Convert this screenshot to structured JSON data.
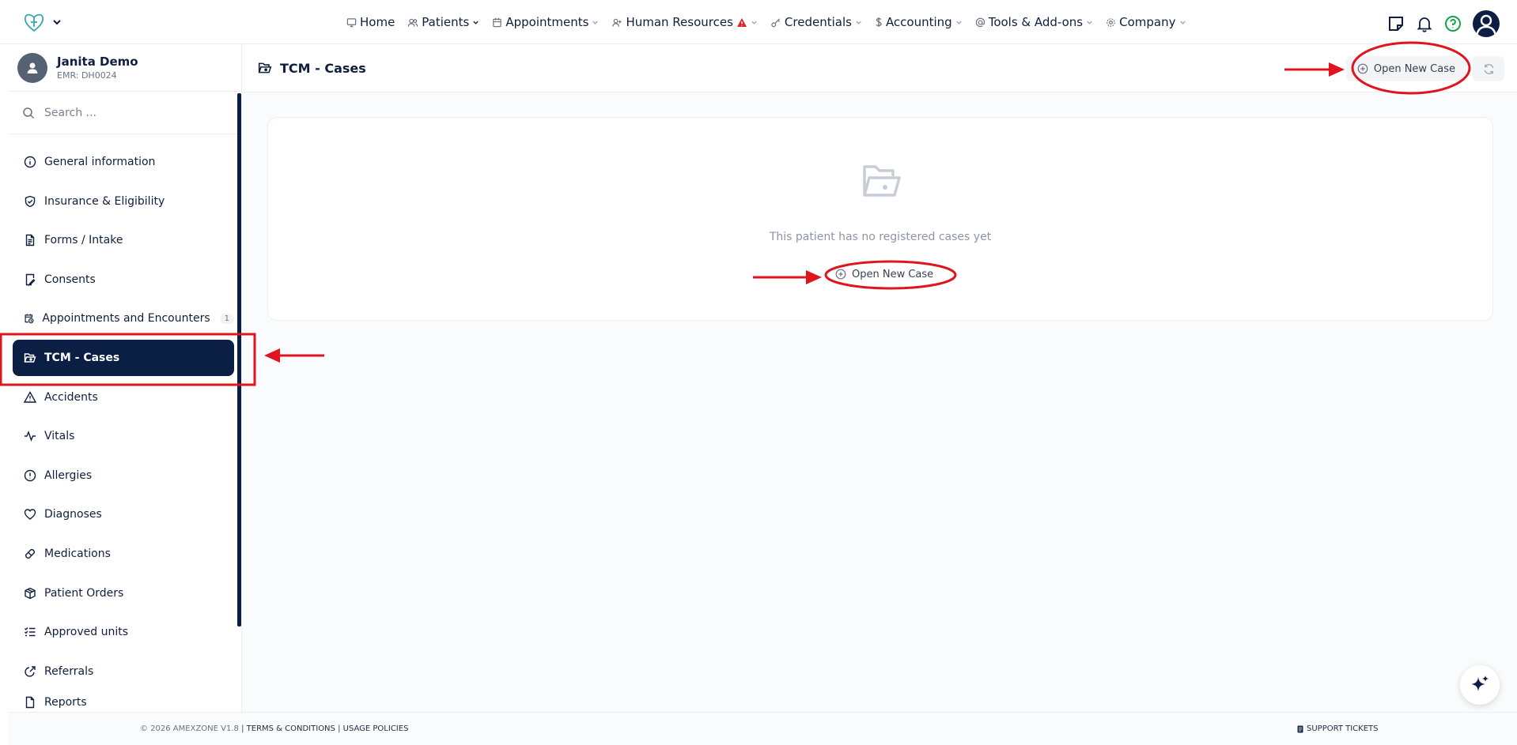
{
  "nav": {
    "items": [
      {
        "label": "Home",
        "icon": "monitor-icon"
      },
      {
        "label": "Patients",
        "icon": "users-icon"
      },
      {
        "label": "Appointments",
        "icon": "calendar-icon"
      },
      {
        "label": "Human Resources",
        "icon": "user-plus-icon"
      },
      {
        "label": "Credentials",
        "icon": "key-icon"
      },
      {
        "label": "Accounting",
        "icon": "dollar-icon"
      },
      {
        "label": "Tools & Add-ons",
        "icon": "at-icon"
      },
      {
        "label": "Company",
        "icon": "gear-icon"
      }
    ]
  },
  "user": {
    "name": "Janita Demo",
    "emr": "EMR: DH0024"
  },
  "search": {
    "placeholder": "Search ..."
  },
  "sidebar": {
    "items": [
      {
        "label": "General information"
      },
      {
        "label": "Insurance & Eligibility"
      },
      {
        "label": "Forms / Intake"
      },
      {
        "label": "Consents"
      },
      {
        "label": "Appointments and Encounters",
        "badge": "1"
      },
      {
        "label": "TCM - Cases"
      },
      {
        "label": "Accidents"
      },
      {
        "label": "Vitals"
      },
      {
        "label": "Allergies"
      },
      {
        "label": "Diagnoses"
      },
      {
        "label": "Medications"
      },
      {
        "label": "Patient Orders"
      },
      {
        "label": "Approved units"
      },
      {
        "label": "Referrals"
      },
      {
        "label": "Reports"
      }
    ]
  },
  "page": {
    "title": "TCM - Cases",
    "open_new_case": "Open New Case",
    "empty_text": "This patient has no registered cases yet",
    "empty_button": "Open New Case"
  },
  "footer": {
    "copyright": "© 2026 AMEXZONE V1.8",
    "separator": "|",
    "terms": "TERMS & CONDITIONS",
    "policies": "USAGE POLICIES",
    "support": "SUPPORT TICKETS"
  },
  "colors": {
    "primary": "#0b1f44",
    "annotation": "#e0141e",
    "help": "#16a34a",
    "warning": "#dc2626"
  }
}
